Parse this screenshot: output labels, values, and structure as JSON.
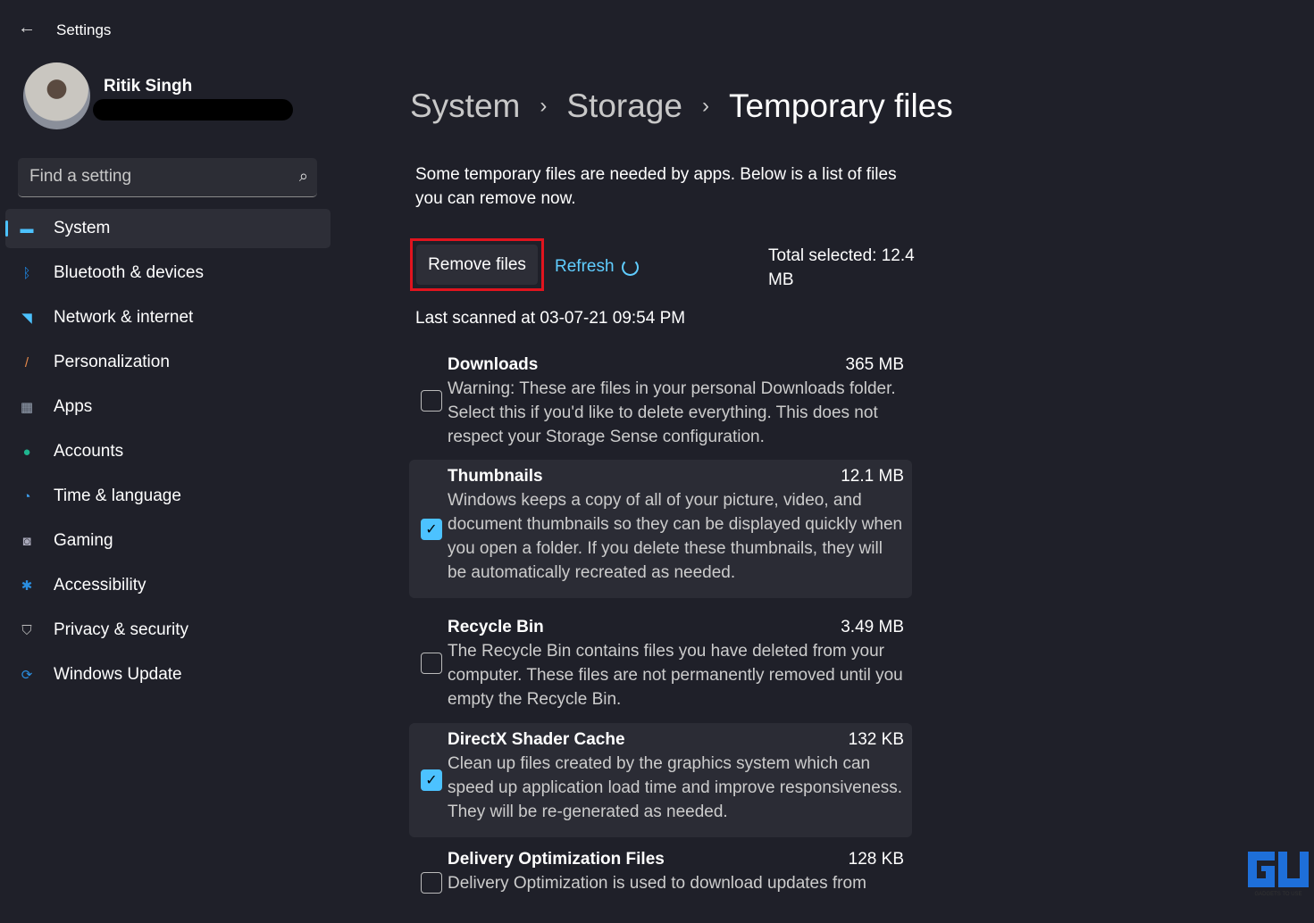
{
  "app": {
    "title": "Settings"
  },
  "user": {
    "name": "Ritik Singh"
  },
  "search": {
    "placeholder": "Find a setting"
  },
  "nav": [
    {
      "label": "System",
      "icon": "system-icon",
      "color": "#4cc2ff"
    },
    {
      "label": "Bluetooth & devices",
      "icon": "bluetooth-icon",
      "color": "#1e88e5"
    },
    {
      "label": "Network & internet",
      "icon": "wifi-icon",
      "color": "#4cc2ff"
    },
    {
      "label": "Personalization",
      "icon": "brush-icon",
      "color": "#e8894a"
    },
    {
      "label": "Apps",
      "icon": "apps-icon",
      "color": "#9aa5b5"
    },
    {
      "label": "Accounts",
      "icon": "accounts-icon",
      "color": "#1fb58f"
    },
    {
      "label": "Time & language",
      "icon": "clock-globe-icon",
      "color": "#3d9be9"
    },
    {
      "label": "Gaming",
      "icon": "gamepad-icon",
      "color": "#aab"
    },
    {
      "label": "Accessibility",
      "icon": "accessibility-icon",
      "color": "#2a8ee0"
    },
    {
      "label": "Privacy & security",
      "icon": "shield-icon",
      "color": "#bbb"
    },
    {
      "label": "Windows Update",
      "icon": "update-icon",
      "color": "#2a8ee0"
    }
  ],
  "breadcrumb": [
    "System",
    "Storage",
    "Temporary files"
  ],
  "description": "Some temporary files are needed by apps. Below is a list of files you can remove now.",
  "actions": {
    "remove": "Remove files",
    "refresh": "Refresh",
    "total": "Total selected: 12.4 MB"
  },
  "last_scanned": "Last scanned at 03-07-21 09:54 PM",
  "items": [
    {
      "name": "Downloads",
      "size": "365 MB",
      "checked": false,
      "text": "Warning: These are files in your personal Downloads folder. Select this if you'd like to delete everything. This does not respect your Storage Sense configuration."
    },
    {
      "name": "Thumbnails",
      "size": "12.1 MB",
      "checked": true,
      "text": "Windows keeps a copy of all of your picture, video, and document thumbnails so they can be displayed quickly when you open a folder. If you delete these thumbnails, they will be automatically recreated as needed."
    },
    {
      "name": "Recycle Bin",
      "size": "3.49 MB",
      "checked": false,
      "text": "The Recycle Bin contains files you have deleted from your computer. These files are not permanently removed until you empty the Recycle Bin."
    },
    {
      "name": "DirectX Shader Cache",
      "size": "132 KB",
      "checked": true,
      "text": "Clean up files created by the graphics system which can speed up application load time and improve responsiveness. They will be re-generated as needed."
    },
    {
      "name": "Delivery Optimization Files",
      "size": "128 KB",
      "checked": false,
      "text": "Delivery Optimization is used to download updates from"
    }
  ],
  "watermark": "GADGETS TO USE"
}
